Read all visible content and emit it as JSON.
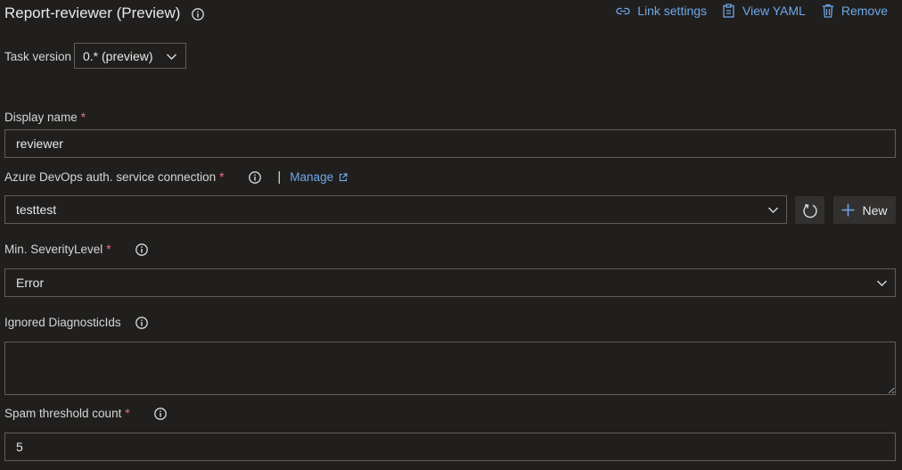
{
  "header": {
    "title": "Report-reviewer (Preview)",
    "title_info_icon": "info-icon",
    "actions": [
      {
        "label": "Link settings",
        "icon": "link-icon"
      },
      {
        "label": "View YAML",
        "icon": "clipboard-icon"
      },
      {
        "label": "Remove",
        "icon": "trash-icon"
      }
    ]
  },
  "task_version": {
    "label": "Task version",
    "value": "0.* (preview)"
  },
  "form": {
    "display_name": {
      "label": "Display name",
      "required": "*",
      "value": "reviewer"
    },
    "service_connection": {
      "label": "Azure DevOps auth. service connection",
      "required": "*",
      "separator": "|",
      "manage_label": "Manage",
      "value": "testtest",
      "new_label": "New"
    },
    "severity": {
      "label": "Min. SeverityLevel",
      "required": "*",
      "value": "Error"
    },
    "ignored": {
      "label": "Ignored DiagnosticIds",
      "value": ""
    },
    "spam": {
      "label": "Spam threshold count",
      "required": "*",
      "value": "5"
    }
  },
  "colors": {
    "background": "#201f1e",
    "link": "#6fa8e8",
    "required": "#f1707b",
    "border": "#605e5c"
  }
}
